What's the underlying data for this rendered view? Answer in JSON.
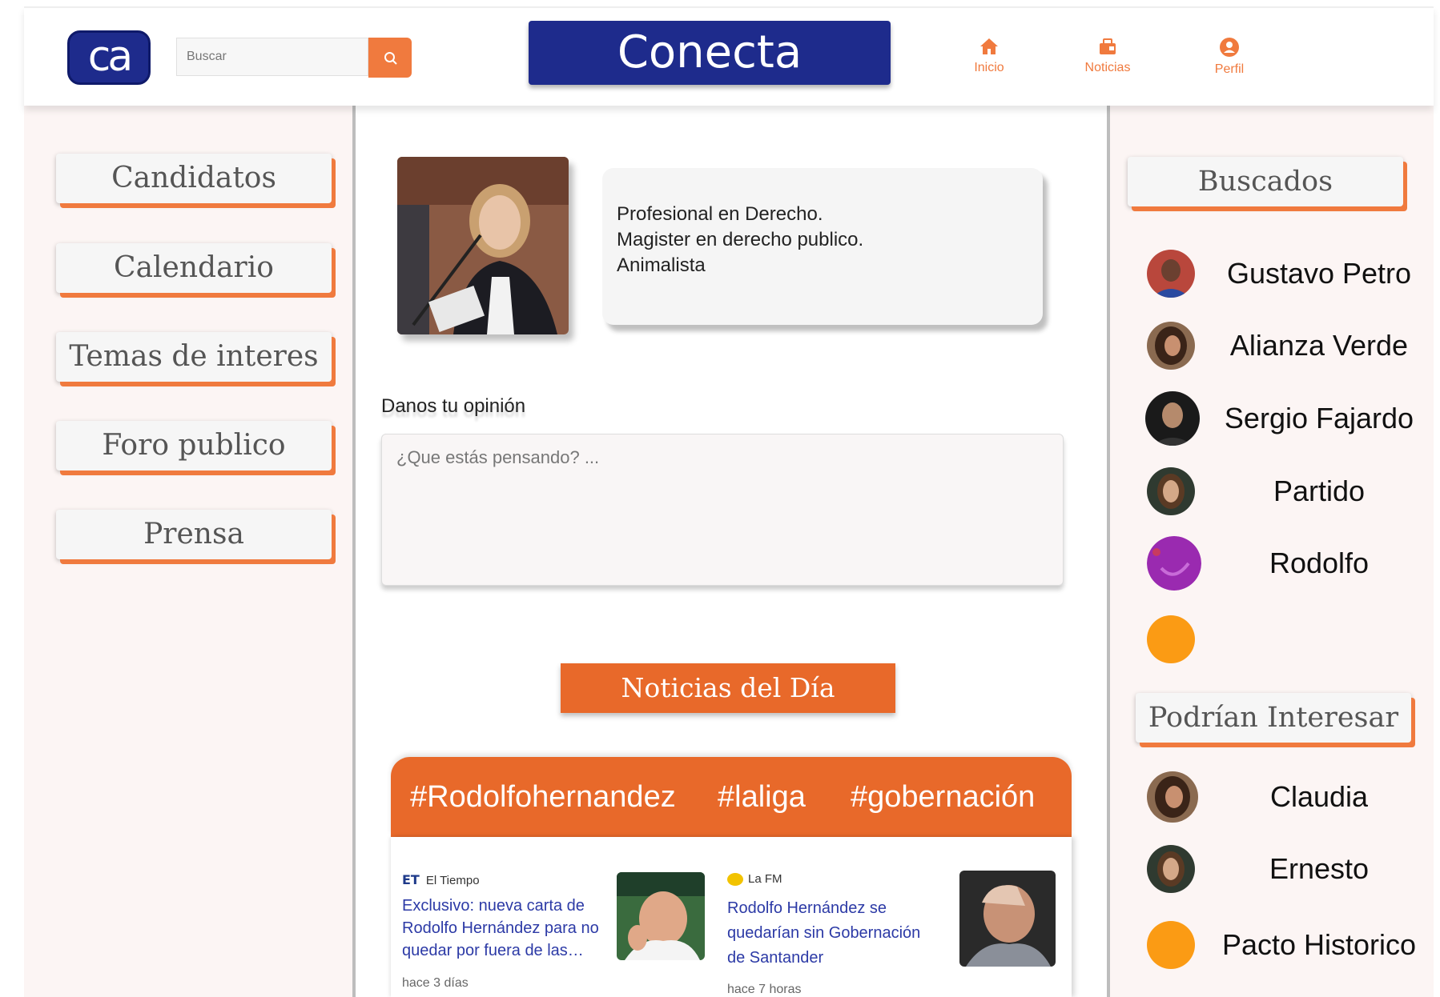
{
  "header": {
    "logo_text": "ca",
    "search_placeholder": "Buscar",
    "brand": "Conecta",
    "nav": [
      {
        "label": "Inicio",
        "icon": "home-icon"
      },
      {
        "label": "Noticias",
        "icon": "news-icon"
      },
      {
        "label": "Perfil",
        "icon": "profile-icon"
      }
    ]
  },
  "sidebar": {
    "items": [
      "Candidatos",
      "Calendario",
      "Temas de interes",
      "Foro publico",
      "Prensa"
    ]
  },
  "profile": {
    "bio": [
      "Profesional en Derecho.",
      "Magister en derecho publico.",
      "Animalista"
    ]
  },
  "opinion": {
    "label": "Danos tu opinión",
    "placeholder": "¿Que estás pensando? ..."
  },
  "news": {
    "title": "Noticias del Día",
    "hashtags": [
      "#Rodolfohernandez",
      "#laliga",
      "#gobernación"
    ],
    "articles": [
      {
        "source_logo": "ET",
        "source": "El Tiempo",
        "headline": "Exclusivo: nueva carta de Rodolfo Hernández para no quedar por fuera de las…",
        "ago": "hace 3 días"
      },
      {
        "source_logo": "FM",
        "source": "La FM",
        "headline": "Rodolfo Hernández se quedarían sin Gobernación de Santander",
        "ago": "hace 7 horas"
      }
    ]
  },
  "buscados": {
    "title": "Buscados",
    "people": [
      "Gustavo Petro",
      "Alianza Verde",
      "Sergio Fajardo",
      "Partido",
      "Rodolfo",
      ""
    ]
  },
  "interesar": {
    "title": "Podrían Interesar",
    "people": [
      "Claudia",
      "Ernesto",
      "Pacto Historico"
    ]
  },
  "colors": {
    "accent": "#f07a3e",
    "brand": "#1e2b8c",
    "headline": "#2c3aa6"
  }
}
